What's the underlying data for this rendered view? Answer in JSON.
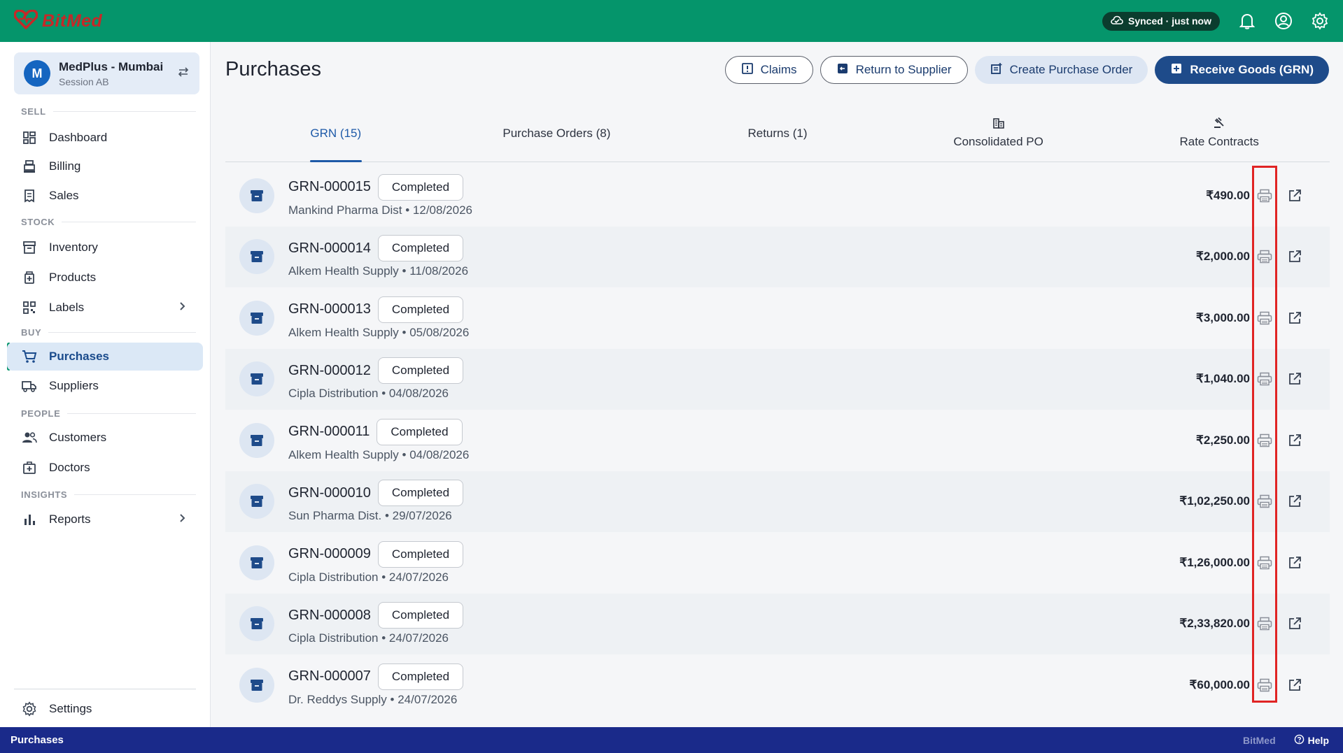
{
  "app": {
    "brand": "BitMed",
    "brand_color": "#c62828",
    "accent": "#05956b"
  },
  "topbar": {
    "sync_status": "Synced · just now",
    "icons": [
      "cloud-sync-icon",
      "bell-icon",
      "account-icon",
      "gear-icon"
    ]
  },
  "sidebar": {
    "org_initial": "M",
    "org_name": "MedPlus - Mumbai",
    "org_session": "Session AB",
    "sections": {
      "sell": "SELL",
      "stock": "STOCK",
      "buy": "BUY",
      "people": "PEOPLE",
      "insights": "INSIGHTS"
    },
    "items": {
      "dashboard": "Dashboard",
      "billing": "Billing",
      "sales": "Sales",
      "inventory": "Inventory",
      "products": "Products",
      "labels": "Labels",
      "purchases": "Purchases",
      "suppliers": "Suppliers",
      "customers": "Customers",
      "doctors": "Doctors",
      "reports": "Reports",
      "settings": "Settings"
    },
    "active": "purchases"
  },
  "page": {
    "title": "Purchases",
    "actions": {
      "claims": "Claims",
      "return_to_supplier": "Return to Supplier",
      "create_po": "Create Purchase Order",
      "receive_goods": "Receive Goods (GRN)"
    },
    "tabs": {
      "grn": "GRN (15)",
      "purchase_orders": "Purchase Orders (8)",
      "returns": "Returns (1)",
      "consolidated_po": "Consolidated PO",
      "rate_contracts": "Rate Contracts"
    },
    "active_tab": "grn"
  },
  "grn_list": [
    {
      "id": "GRN-000015",
      "status": "Completed",
      "supplier": "Mankind Pharma Dist",
      "date": "12/08/2026",
      "amount": "₹490.00"
    },
    {
      "id": "GRN-000014",
      "status": "Completed",
      "supplier": "Alkem Health Supply",
      "date": "11/08/2026",
      "amount": "₹2,000.00"
    },
    {
      "id": "GRN-000013",
      "status": "Completed",
      "supplier": "Alkem Health Supply",
      "date": "05/08/2026",
      "amount": "₹3,000.00"
    },
    {
      "id": "GRN-000012",
      "status": "Completed",
      "supplier": "Cipla Distribution",
      "date": "04/08/2026",
      "amount": "₹1,040.00"
    },
    {
      "id": "GRN-000011",
      "status": "Completed",
      "supplier": "Alkem Health Supply",
      "date": "04/08/2026",
      "amount": "₹2,250.00"
    },
    {
      "id": "GRN-000010",
      "status": "Completed",
      "supplier": "Sun Pharma Dist.",
      "date": "29/07/2026",
      "amount": "₹1,02,250.00"
    },
    {
      "id": "GRN-000009",
      "status": "Completed",
      "supplier": "Cipla Distribution",
      "date": "24/07/2026",
      "amount": "₹1,26,000.00"
    },
    {
      "id": "GRN-000008",
      "status": "Completed",
      "supplier": "Cipla Distribution",
      "date": "24/07/2026",
      "amount": "₹2,33,820.00"
    },
    {
      "id": "GRN-000007",
      "status": "Completed",
      "supplier": "Dr. Reddys Supply",
      "date": "24/07/2026",
      "amount": "₹60,000.00"
    }
  ],
  "statusbar": {
    "left": "Purchases",
    "brand": "BitMed",
    "help": "Help"
  }
}
